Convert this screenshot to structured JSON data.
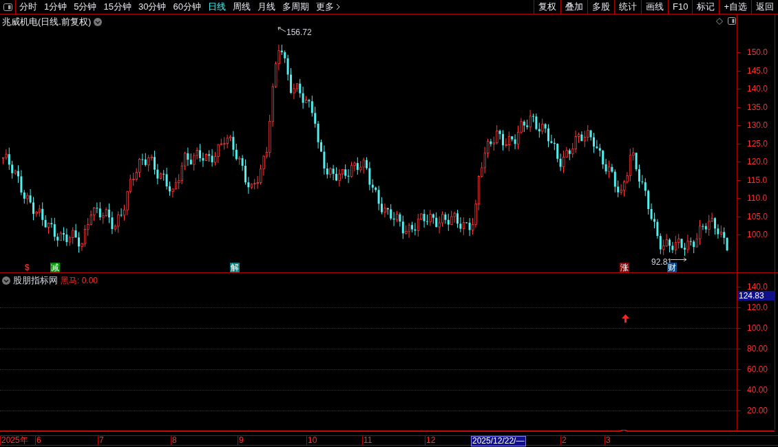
{
  "toolbar": {
    "periods": [
      {
        "label": "分时",
        "selected": false
      },
      {
        "label": "1分钟",
        "selected": false
      },
      {
        "label": "5分钟",
        "selected": false
      },
      {
        "label": "15分钟",
        "selected": false
      },
      {
        "label": "30分钟",
        "selected": false
      },
      {
        "label": "60分钟",
        "selected": false
      },
      {
        "label": "日线",
        "selected": true
      },
      {
        "label": "周线",
        "selected": false
      },
      {
        "label": "月线",
        "selected": false
      },
      {
        "label": "多周期",
        "selected": false
      }
    ],
    "more": "更多",
    "buttons": [
      "复权",
      "叠加",
      "多股",
      "统计",
      "画线",
      "F10",
      "标记",
      "+自选",
      "返回"
    ]
  },
  "main_chart": {
    "title": "兆威机电(日线.前复权)",
    "y_ticks": [
      "150.0",
      "145.0",
      "140.0",
      "135.0",
      "130.0",
      "125.0",
      "120.0",
      "115.0",
      "110.0",
      "105.0",
      "100.0"
    ],
    "high_label": "156.72",
    "low_label": "92.81",
    "markers": [
      {
        "kind": "sign",
        "text": "$",
        "color": "#ff2020"
      },
      {
        "kind": "tag",
        "text": "减",
        "color": "#0a8a0a"
      },
      {
        "kind": "tag",
        "text": "解",
        "color": "#0a8080"
      },
      {
        "kind": "tag",
        "text": "涨",
        "color": "#8a0a0a"
      },
      {
        "kind": "tag",
        "text": "财",
        "color": "#0a4a8a"
      }
    ]
  },
  "indicator": {
    "name": "股朋指标网",
    "value_label": "黑马: 0.00",
    "current_value": "124.83",
    "y_ticks": [
      "140.0",
      "120.0",
      "100.0",
      "80.00",
      "60.00",
      "40.00",
      "20.00"
    ]
  },
  "date_axis": {
    "labels": [
      "2025年",
      "6",
      "7",
      "8",
      "9",
      "10",
      "11",
      "12",
      "2",
      "3"
    ],
    "cursor_label": "2025/12/22/—"
  }
}
